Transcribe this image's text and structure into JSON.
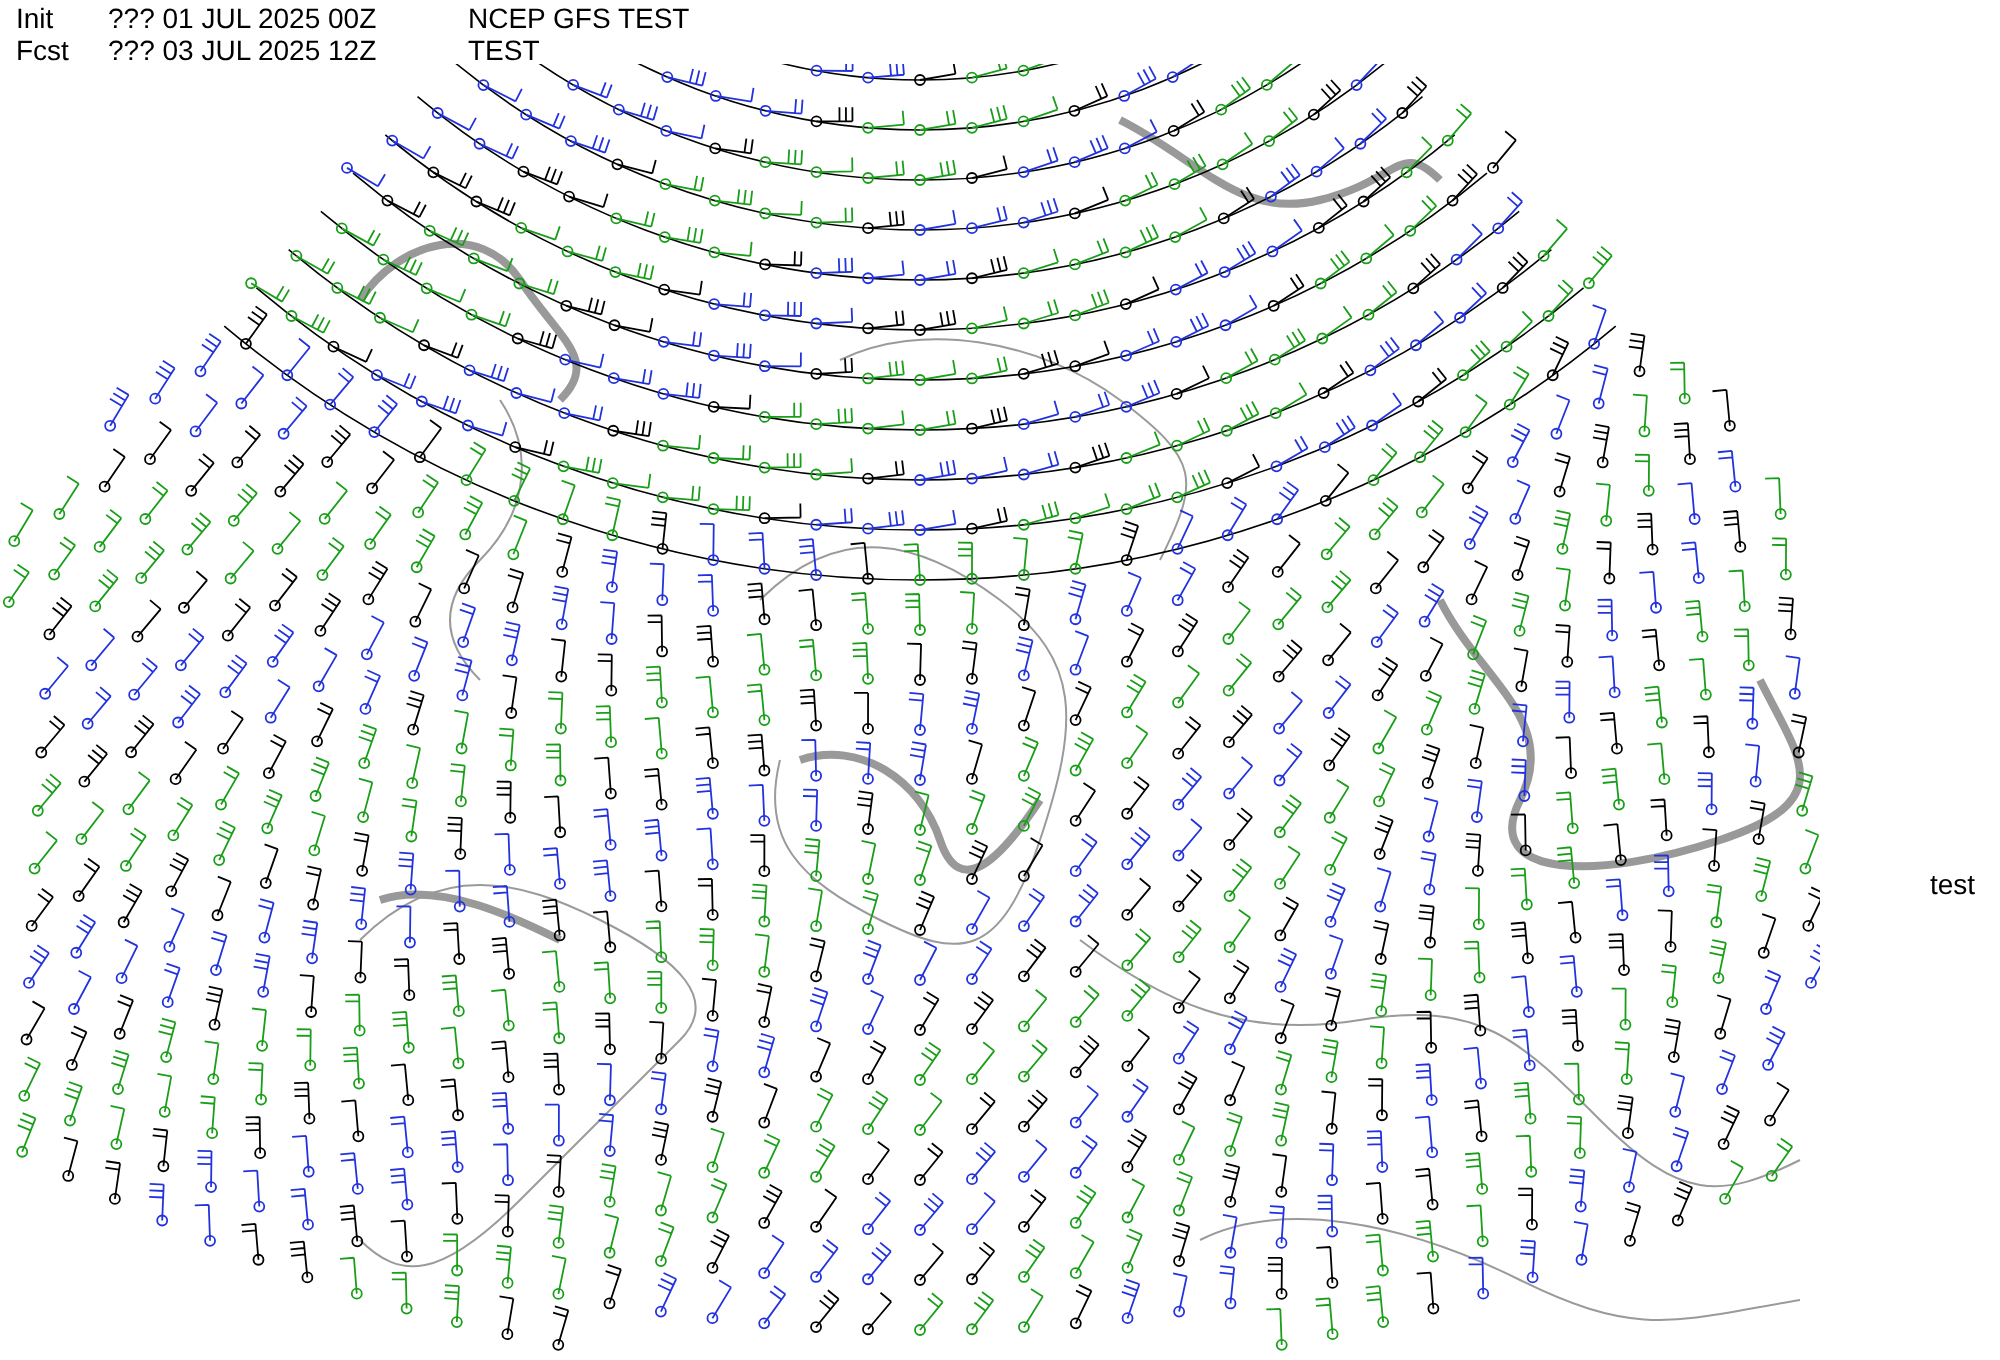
{
  "header": [
    {
      "label": "Init",
      "time": "??? 01 JUL 2025 00Z",
      "title": "NCEP GFS TEST"
    },
    {
      "label": "Fcst",
      "time": "??? 03 JUL 2025 12Z",
      "title": "TEST"
    }
  ],
  "side_label": "test"
}
